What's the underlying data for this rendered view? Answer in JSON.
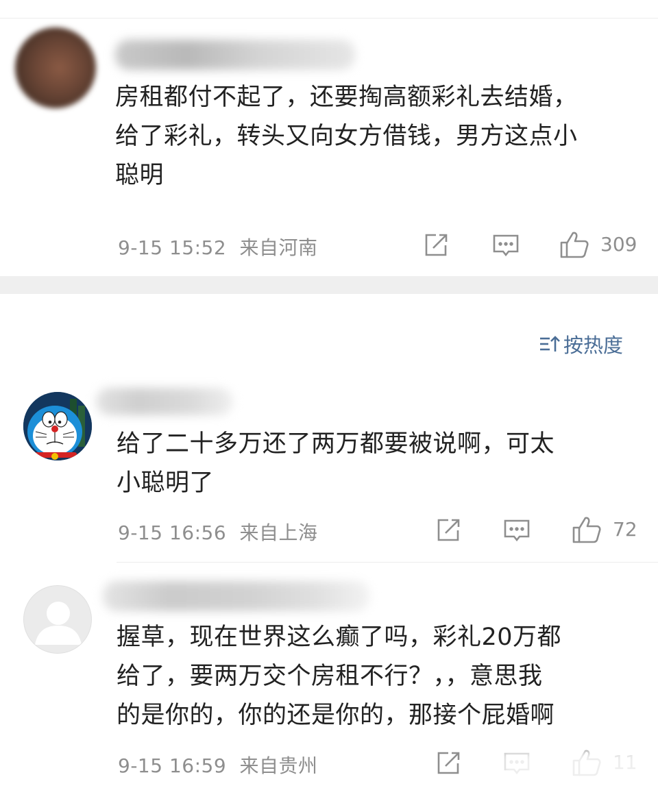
{
  "comments": [
    {
      "text_lines": [
        "房租都付不起了，还要掏高额彩礼去结婚，",
        "给了彩礼，转头又向女方借钱，男方这点小",
        "聪明"
      ],
      "time": "9-15 15:52",
      "location": "来自河南",
      "likes": "309",
      "avatar_icon": "blurred-face-avatar"
    },
    {
      "text_lines": [
        "给了二十多万还了两万都要被说啊，可太",
        "小聪明了"
      ],
      "time": "9-15 16:56",
      "location": "来自上海",
      "likes": "72",
      "avatar_icon": "doraemon-avatar"
    },
    {
      "text_lines": [
        "握草，现在世界这么癫了吗，彩礼20万都",
        "给了，要两万交个房租不行？，，意思我",
        "的是你的，你的还是你的，那接个屁婚啊"
      ],
      "time": "9-15 16:59",
      "location": "来自贵州",
      "likes": "11",
      "avatar_icon": "default-person-avatar"
    }
  ],
  "sort": {
    "label": "按热度",
    "icon": "sort-icon"
  },
  "colors": {
    "accent": "#4a6d96",
    "meta": "#8e8e8e",
    "text": "#222222",
    "band": "#efefef"
  }
}
